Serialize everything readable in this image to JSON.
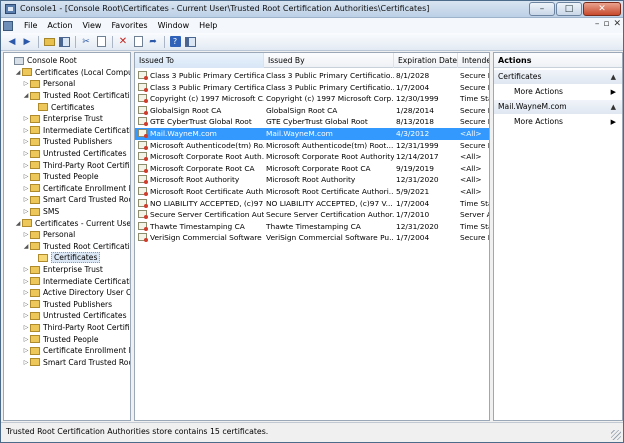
{
  "window": {
    "title": "Console1 - [Console Root\\Certificates - Current User\\Trusted Root Certification Authorities\\Certificates]",
    "minimize_glyph": "–",
    "maximize_glyph": "□",
    "close_glyph": "✕"
  },
  "menu": {
    "items": [
      "File",
      "Action",
      "View",
      "Favorites",
      "Window",
      "Help"
    ],
    "right_controls": [
      "–",
      "▫",
      "✕"
    ]
  },
  "toolbar": {
    "icons": [
      "back-arrow-icon",
      "forward-arrow-icon",
      "up-folder-icon",
      "show-hide-tree-icon",
      "cut-icon",
      "copy-icon",
      "delete-icon",
      "properties-icon",
      "export-icon",
      "help-icon",
      "show-hide-action-pane-icon"
    ]
  },
  "tree": {
    "items": [
      {
        "label": "Console Root",
        "indent": 0,
        "toggle": "",
        "icon": "root"
      },
      {
        "label": "Certificates (Local Computer)",
        "indent": 1,
        "toggle": "◢",
        "icon": "folder"
      },
      {
        "label": "Personal",
        "indent": 2,
        "toggle": "▷",
        "icon": "folder"
      },
      {
        "label": "Trusted Root Certification",
        "indent": 2,
        "toggle": "◢",
        "icon": "folder"
      },
      {
        "label": "Certificates",
        "indent": 3,
        "toggle": "",
        "icon": "folder"
      },
      {
        "label": "Enterprise Trust",
        "indent": 2,
        "toggle": "▷",
        "icon": "folder"
      },
      {
        "label": "Intermediate Certification",
        "indent": 2,
        "toggle": "▷",
        "icon": "folder"
      },
      {
        "label": "Trusted Publishers",
        "indent": 2,
        "toggle": "▷",
        "icon": "folder"
      },
      {
        "label": "Untrusted Certificates",
        "indent": 2,
        "toggle": "▷",
        "icon": "folder"
      },
      {
        "label": "Third-Party Root Certification",
        "indent": 2,
        "toggle": "▷",
        "icon": "folder"
      },
      {
        "label": "Trusted People",
        "indent": 2,
        "toggle": "▷",
        "icon": "folder"
      },
      {
        "label": "Certificate Enrollment Requests",
        "indent": 2,
        "toggle": "▷",
        "icon": "folder"
      },
      {
        "label": "Smart Card Trusted Roots",
        "indent": 2,
        "toggle": "▷",
        "icon": "folder"
      },
      {
        "label": "SMS",
        "indent": 2,
        "toggle": "▷",
        "icon": "folder"
      },
      {
        "label": "Certificates - Current User",
        "indent": 1,
        "toggle": "◢",
        "icon": "folder"
      },
      {
        "label": "Personal",
        "indent": 2,
        "toggle": "▷",
        "icon": "folder"
      },
      {
        "label": "Trusted Root Certification",
        "indent": 2,
        "toggle": "◢",
        "icon": "folder"
      },
      {
        "label": "Certificates",
        "indent": 3,
        "toggle": "",
        "icon": "open",
        "selected": true
      },
      {
        "label": "Enterprise Trust",
        "indent": 2,
        "toggle": "▷",
        "icon": "folder"
      },
      {
        "label": "Intermediate Certification",
        "indent": 2,
        "toggle": "▷",
        "icon": "folder"
      },
      {
        "label": "Active Directory User Object",
        "indent": 2,
        "toggle": "▷",
        "icon": "folder"
      },
      {
        "label": "Trusted Publishers",
        "indent": 2,
        "toggle": "▷",
        "icon": "folder"
      },
      {
        "label": "Untrusted Certificates",
        "indent": 2,
        "toggle": "▷",
        "icon": "folder"
      },
      {
        "label": "Third-Party Root Certification",
        "indent": 2,
        "toggle": "▷",
        "icon": "folder"
      },
      {
        "label": "Trusted People",
        "indent": 2,
        "toggle": "▷",
        "icon": "folder"
      },
      {
        "label": "Certificate Enrollment Requests",
        "indent": 2,
        "toggle": "▷",
        "icon": "folder"
      },
      {
        "label": "Smart Card Trusted Roots",
        "indent": 2,
        "toggle": "▷",
        "icon": "folder"
      }
    ]
  },
  "list": {
    "columns": [
      "Issued To",
      "Issued By",
      "Expiration Date",
      "Intended Purposes"
    ],
    "rows": [
      {
        "issued_to": "Class 3 Public Primary Certificat...",
        "issued_by": "Class 3 Public Primary Certificatio...",
        "expires": "8/1/2028",
        "purposes": "Secure E"
      },
      {
        "issued_to": "Class 3 Public Primary Certificat...",
        "issued_by": "Class 3 Public Primary Certificatio...",
        "expires": "1/7/2004",
        "purposes": "Secure E"
      },
      {
        "issued_to": "Copyright (c) 1997 Microsoft C...",
        "issued_by": "Copyright (c) 1997 Microsoft Corp.",
        "expires": "12/30/1999",
        "purposes": "Time Sta"
      },
      {
        "issued_to": "GlobalSign Root CA",
        "issued_by": "GlobalSign Root CA",
        "expires": "1/28/2014",
        "purposes": "Secure E"
      },
      {
        "issued_to": "GTE CyberTrust Global Root",
        "issued_by": "GTE CyberTrust Global Root",
        "expires": "8/13/2018",
        "purposes": "Secure E"
      },
      {
        "issued_to": "Mail.WayneM.com",
        "issued_by": "Mail.WayneM.com",
        "expires": "4/3/2012",
        "purposes": "<All>",
        "selected": true
      },
      {
        "issued_to": "Microsoft Authenticode(tm) Ro...",
        "issued_by": "Microsoft Authenticode(tm) Root...",
        "expires": "12/31/1999",
        "purposes": "Secure E"
      },
      {
        "issued_to": "Microsoft Corporate Root Auth...",
        "issued_by": "Microsoft Corporate Root Authority",
        "expires": "12/14/2017",
        "purposes": "<All>"
      },
      {
        "issued_to": "Microsoft Corporate Root CA",
        "issued_by": "Microsoft Corporate Root CA",
        "expires": "9/19/2019",
        "purposes": "<All>"
      },
      {
        "issued_to": "Microsoft Root Authority",
        "issued_by": "Microsoft Root Authority",
        "expires": "12/31/2020",
        "purposes": "<All>"
      },
      {
        "issued_to": "Microsoft Root Certificate Auth...",
        "issued_by": "Microsoft Root Certificate Authori...",
        "expires": "5/9/2021",
        "purposes": "<All>"
      },
      {
        "issued_to": "NO LIABILITY ACCEPTED, (c)97 ...",
        "issued_by": "NO LIABILITY ACCEPTED, (c)97 V...",
        "expires": "1/7/2004",
        "purposes": "Time Sta"
      },
      {
        "issued_to": "Secure Server Certification Auth...",
        "issued_by": "Secure Server Certification Author...",
        "expires": "1/7/2010",
        "purposes": "Server A"
      },
      {
        "issued_to": "Thawte Timestamping CA",
        "issued_by": "Thawte Timestamping CA",
        "expires": "12/31/2020",
        "purposes": "Time Sta"
      },
      {
        "issued_to": "VeriSign Commercial Software ...",
        "issued_by": "VeriSign Commercial Software Pu...",
        "expires": "1/7/2004",
        "purposes": "Secure E"
      }
    ]
  },
  "actions": {
    "header": "Actions",
    "sections": [
      {
        "title": "Certificates",
        "collapse_glyph": "▲",
        "items": [
          {
            "label": "More Actions",
            "arrow": "▶"
          }
        ]
      },
      {
        "title": "Mail.WayneM.com",
        "collapse_glyph": "▲",
        "items": [
          {
            "label": "More Actions",
            "arrow": "▶"
          }
        ]
      }
    ]
  },
  "status": {
    "text": "Trusted Root Certification Authorities store contains 15 certificates."
  }
}
